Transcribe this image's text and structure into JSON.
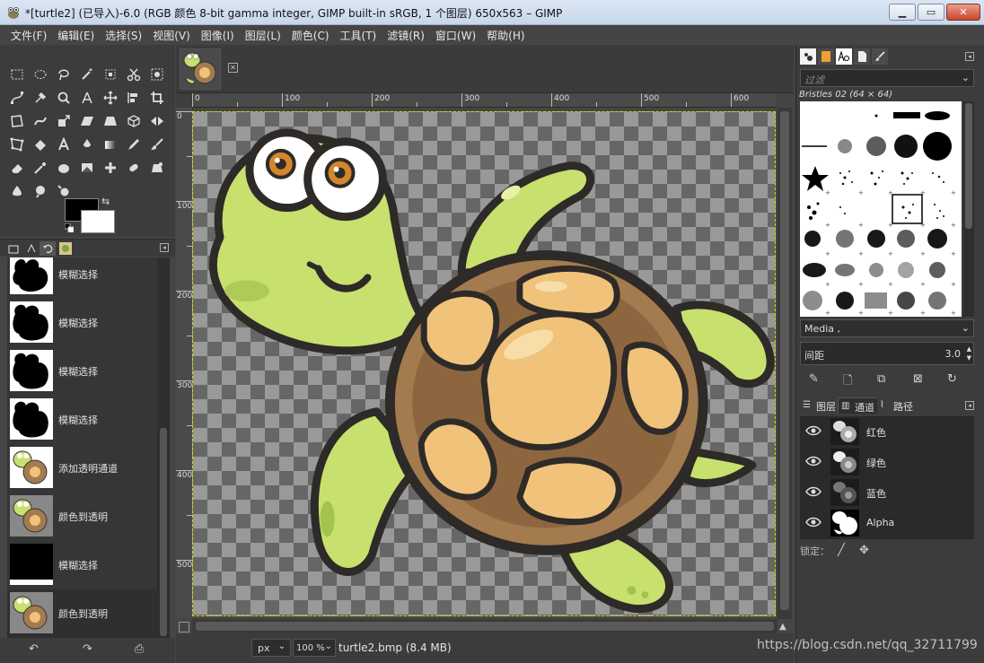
{
  "window": {
    "title": "*[turtle2] (已导入)-6.0 (RGB 颜色 8-bit gamma integer, GIMP built-in sRGB, 1 个图层) 650x563 – GIMP",
    "min_symbol": "▁",
    "max_symbol": "▭",
    "close_symbol": "✕"
  },
  "menu": [
    "文件(F)",
    "编辑(E)",
    "选择(S)",
    "视图(V)",
    "图像(I)",
    "图层(L)",
    "颜色(C)",
    "工具(T)",
    "滤镜(R)",
    "窗口(W)",
    "帮助(H)"
  ],
  "colors": {
    "foreground": "#000000",
    "background": "#ffffff",
    "selection_border": "#e2d200",
    "turtle_skin": "#c7e06e",
    "turtle_shell": "#a47a4f",
    "turtle_plates": "#f0c27a"
  },
  "undo_history": [
    {
      "label": "模糊选择",
      "thumb": "mask"
    },
    {
      "label": "模糊选择",
      "thumb": "mask"
    },
    {
      "label": "模糊选择",
      "thumb": "mask"
    },
    {
      "label": "模糊选择",
      "thumb": "mask"
    },
    {
      "label": "添加透明通道",
      "thumb": "turtle"
    },
    {
      "label": "颜色到透明",
      "thumb": "turtle"
    },
    {
      "label": "模糊选择",
      "thumb": "black"
    },
    {
      "label": "颜色到透明",
      "thumb": "turtle"
    }
  ],
  "history_buttons": {
    "undo": "↶",
    "redo": "↷",
    "clear": "⎙"
  },
  "ruler": {
    "top_labels": [
      "0",
      "100",
      "200",
      "300",
      "400",
      "500",
      "600"
    ],
    "left_labels": [
      "0",
      "100",
      "200",
      "300",
      "400",
      "500"
    ]
  },
  "statusbar": {
    "unit": "px",
    "zoom": "100 %",
    "file_info": "turtle2.bmp (8.4 MB)"
  },
  "watermark": "https://blog.csdn.net/qq_32711799",
  "brushes": {
    "filter_placeholder": "过滤",
    "current_brush": "Bristles 02 (64 × 64)",
    "tag": "Media ,",
    "spacing_label": "间距",
    "spacing_value": "3.0"
  },
  "channels_panel": {
    "tabs": [
      "图层",
      "通道",
      "路径"
    ],
    "active_tab": "通道",
    "channels": [
      {
        "name": "红色"
      },
      {
        "name": "绿色"
      },
      {
        "name": "蓝色"
      },
      {
        "name": "Alpha"
      }
    ],
    "lock_label": "锁定："
  }
}
